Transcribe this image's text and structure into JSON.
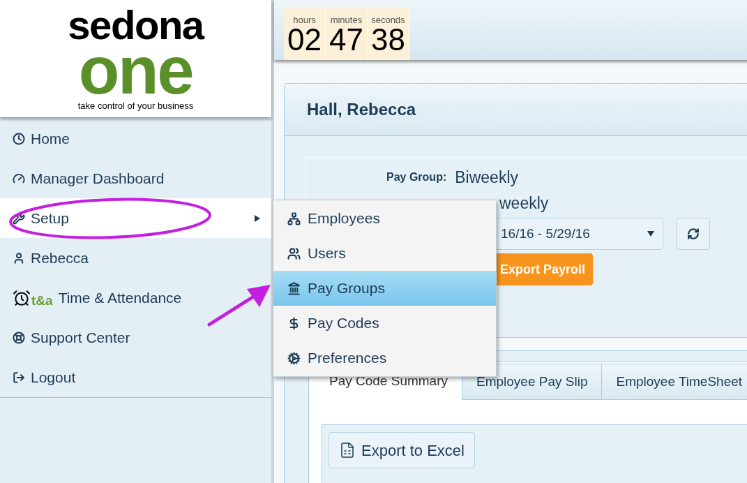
{
  "logo": {
    "word_1": "sedona",
    "word_2": "one",
    "tagline": "take control of your business"
  },
  "timer": [
    {
      "unit": "hours",
      "value": "02"
    },
    {
      "unit": "minutes",
      "value": "47"
    },
    {
      "unit": "seconds",
      "value": "38"
    }
  ],
  "nav": [
    {
      "label": "Home",
      "selected": false,
      "submenu": false
    },
    {
      "label": "Manager Dashboard",
      "selected": false,
      "submenu": false
    },
    {
      "label": "Setup",
      "selected": true,
      "submenu": true
    },
    {
      "label": "Rebecca",
      "selected": false,
      "submenu": false
    },
    {
      "label": "Time & Attendance",
      "icon_text": "t&a",
      "selected": false,
      "submenu": false
    },
    {
      "label": "Support Center",
      "selected": false,
      "submenu": false
    },
    {
      "label": "Logout",
      "selected": false,
      "submenu": false
    }
  ],
  "submenu": [
    {
      "label": "Employees",
      "selected": false
    },
    {
      "label": "Users",
      "selected": false
    },
    {
      "label": "Pay Groups",
      "selected": true
    },
    {
      "label": "Pay Codes",
      "selected": false
    },
    {
      "label": "Preferences",
      "selected": false
    }
  ],
  "employee": {
    "name": "Hall, Rebecca",
    "pay_group_label": "Pay Group:",
    "pay_group": "Biweekly",
    "row_2_value": "weekly",
    "period": "16/16 - 5/29/16",
    "export_button": "Export Payroll"
  },
  "tabs": [
    {
      "label": "Pay Code Summary",
      "selected": true
    },
    {
      "label": "Employee Pay Slip",
      "selected": false
    },
    {
      "label": "Employee TimeSheet",
      "selected": false
    }
  ],
  "export_excel": "Export to Excel"
}
